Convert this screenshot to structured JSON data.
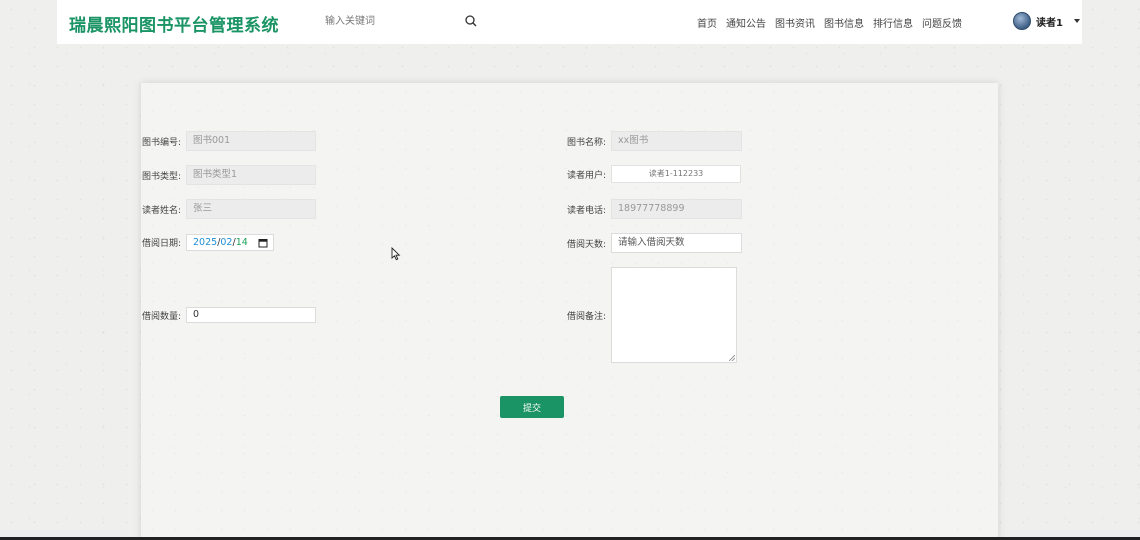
{
  "header": {
    "site_title": "瑞晨熙阳图书平台管理系统",
    "search_placeholder": "输入关键词",
    "nav": [
      "首页",
      "通知公告",
      "图书资讯",
      "图书信息",
      "排行信息",
      "问题反馈"
    ],
    "user_name": "读者1"
  },
  "form": {
    "book_no": {
      "label": "图书编号:",
      "value": "图书001"
    },
    "book_name": {
      "label": "图书名称:",
      "value": "xx图书"
    },
    "book_type": {
      "label": "图书类型:",
      "value": "图书类型1"
    },
    "reader_user": {
      "label": "读者用户:",
      "value": "读者1-112233"
    },
    "reader_name": {
      "label": "读者姓名:",
      "value": "张三"
    },
    "reader_phone": {
      "label": "读者电话:",
      "value": "18977778899"
    },
    "borrow_date": {
      "label": "借阅日期:",
      "year": "2025",
      "month": "02",
      "day": "14",
      "sep": "/"
    },
    "borrow_days": {
      "label": "借阅天数:",
      "placeholder": "请输入借阅天数"
    },
    "borrow_qty": {
      "label": "借阅数量:",
      "value": "0"
    },
    "remark": {
      "label": "借阅备注:"
    },
    "submit_label": "提交"
  },
  "colors": {
    "brand": "#1a9464"
  },
  "icons": [
    "search-icon",
    "calendar-icon",
    "caret-down-icon",
    "cursor-icon"
  ]
}
